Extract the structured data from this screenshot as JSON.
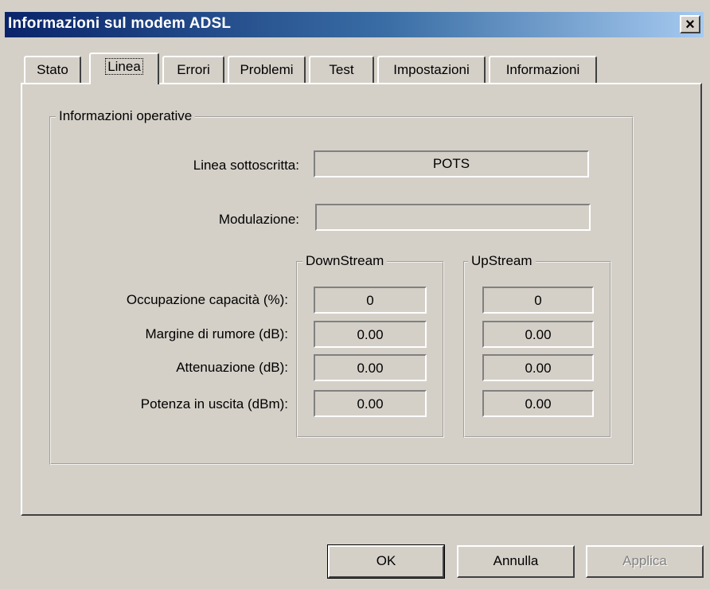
{
  "window": {
    "title": "Informazioni sul modem ADSL",
    "close_label": "×"
  },
  "tabs": [
    {
      "label": "Stato",
      "active": false
    },
    {
      "label": "Linea",
      "active": true
    },
    {
      "label": "Errori",
      "active": false
    },
    {
      "label": "Problemi",
      "active": false
    },
    {
      "label": "Test",
      "active": false
    },
    {
      "label": "Impostazioni",
      "active": false
    },
    {
      "label": "Informazioni",
      "active": false
    }
  ],
  "operative": {
    "title": "Informazioni operative",
    "subscribed_line_label": "Linea sottoscritta:",
    "subscribed_line_value": "POTS",
    "modulation_label": "Modulazione:",
    "modulation_value": ""
  },
  "streams": {
    "down_title": "DownStream",
    "up_title": "UpStream",
    "rows": [
      {
        "label": "Occupazione capacità (%):",
        "down": "0",
        "up": "0"
      },
      {
        "label": "Margine di rumore (dB):",
        "down": "0.00",
        "up": "0.00"
      },
      {
        "label": "Attenuazione (dB):",
        "down": "0.00",
        "up": "0.00"
      },
      {
        "label": "Potenza in uscita (dBm):",
        "down": "0.00",
        "up": "0.00"
      }
    ]
  },
  "buttons": {
    "ok": "OK",
    "cancel": "Annulla",
    "apply": "Applica"
  }
}
